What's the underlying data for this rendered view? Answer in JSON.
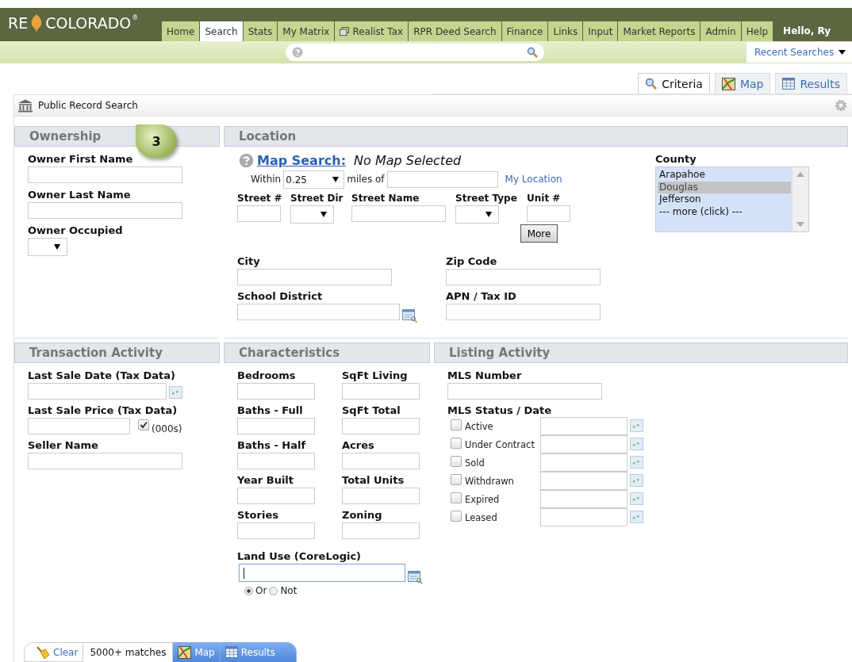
{
  "header": {
    "logo": {
      "prefix": "RE",
      "name": "COLORADO",
      "mark": "®"
    },
    "nav": [
      {
        "label": "Home",
        "selected": false,
        "kind": "plain"
      },
      {
        "label": "Search",
        "selected": true,
        "kind": "plain"
      },
      {
        "label": "Stats",
        "selected": false,
        "kind": "plain"
      },
      {
        "label": "My Matrix",
        "selected": false,
        "kind": "plain"
      },
      {
        "label": "Realist Tax",
        "selected": false,
        "kind": "window"
      },
      {
        "label": "RPR Deed Search",
        "selected": false,
        "kind": "plain"
      },
      {
        "label": "Finance",
        "selected": false,
        "kind": "plain"
      },
      {
        "label": "Links",
        "selected": false,
        "kind": "plain"
      },
      {
        "label": "Input",
        "selected": false,
        "kind": "plain"
      },
      {
        "label": "Market Reports",
        "selected": false,
        "kind": "plain"
      },
      {
        "label": "Admin",
        "selected": false,
        "kind": "plain"
      },
      {
        "label": "Help",
        "selected": false,
        "kind": "plain"
      }
    ],
    "greeting": "Hello, Ry"
  },
  "search_bar": {
    "recent_searches": "Recent Searches"
  },
  "view_tabs": [
    {
      "label": "Criteria",
      "selected": true,
      "kind": "search"
    },
    {
      "label": "Map",
      "selected": false,
      "kind": "map"
    },
    {
      "label": "Results",
      "selected": false,
      "kind": "table"
    }
  ],
  "panel": {
    "title": "Public Record Search"
  },
  "step_badge": "3",
  "ownership": {
    "title": "Ownership",
    "fields": [
      {
        "label": "Owner First Name",
        "kind": "text"
      },
      {
        "label": "Owner Last Name",
        "kind": "text"
      },
      {
        "label": "Owner Occupied",
        "kind": "select"
      }
    ]
  },
  "location": {
    "title": "Location",
    "map_search": {
      "link": "Map Search:",
      "status": "No Map Selected"
    },
    "radius": {
      "prefix": "Within",
      "value": "0.25",
      "suffix": "miles of",
      "link": "My Location"
    },
    "street_fields": [
      {
        "label": "Street #",
        "kind": "text"
      },
      {
        "label": "Street Dir",
        "kind": "select"
      },
      {
        "label": "Street Name",
        "kind": "text"
      },
      {
        "label": "Street Type",
        "kind": "select"
      },
      {
        "label": "Unit #",
        "kind": "text"
      }
    ],
    "more_button": "More",
    "fields": [
      {
        "label": "City",
        "kind": "text"
      },
      {
        "label": "Zip Code",
        "kind": "text"
      },
      {
        "label": "School District",
        "kind": "lookup"
      },
      {
        "label": "APN / Tax ID",
        "kind": "text"
      }
    ],
    "county": {
      "label": "County",
      "options": [
        {
          "label": "Arapahoe",
          "selected": false
        },
        {
          "label": "Douglas",
          "selected": true
        },
        {
          "label": "Jefferson",
          "selected": false
        },
        {
          "label": "--- more (click) ---",
          "selected": false
        }
      ]
    }
  },
  "transaction": {
    "title": "Transaction Activity",
    "fields": [
      {
        "label": "Last Sale Date (Tax Data)",
        "kind": "date"
      },
      {
        "label": "Last Sale Price (Tax Data)",
        "kind": "price",
        "unit": "(000s)",
        "checked": true
      },
      {
        "label": "Seller Name",
        "kind": "text"
      }
    ]
  },
  "characteristics": {
    "title": "Characteristics",
    "fields": [
      {
        "label": "Bedrooms",
        "kind": "text"
      },
      {
        "label": "SqFt Living",
        "kind": "text"
      },
      {
        "label": "Baths - Full",
        "kind": "text"
      },
      {
        "label": "SqFt Total",
        "kind": "text"
      },
      {
        "label": "Baths - Half",
        "kind": "text"
      },
      {
        "label": "Acres",
        "kind": "text"
      },
      {
        "label": "Year Built",
        "kind": "text"
      },
      {
        "label": "Total Units",
        "kind": "text"
      },
      {
        "label": "Stories",
        "kind": "text"
      },
      {
        "label": "Zoning",
        "kind": "text"
      }
    ],
    "land_use": {
      "label": "Land Use (CoreLogic)",
      "focused": true,
      "modes": [
        {
          "label": "Or",
          "selected": true
        },
        {
          "label": "Not",
          "selected": false
        }
      ]
    }
  },
  "listing": {
    "title": "Listing Activity",
    "mls_number": "MLS Number",
    "status_label": "MLS Status / Date",
    "statuses": [
      {
        "label": "Active",
        "checked": false
      },
      {
        "label": "Under Contract",
        "checked": false
      },
      {
        "label": "Sold",
        "checked": false
      },
      {
        "label": "Withdrawn",
        "checked": false
      },
      {
        "label": "Expired",
        "checked": false
      },
      {
        "label": "Leased",
        "checked": false
      }
    ]
  },
  "footer": {
    "clear": "Clear",
    "matches": "5000+ matches",
    "map": "Map",
    "results": "Results"
  }
}
